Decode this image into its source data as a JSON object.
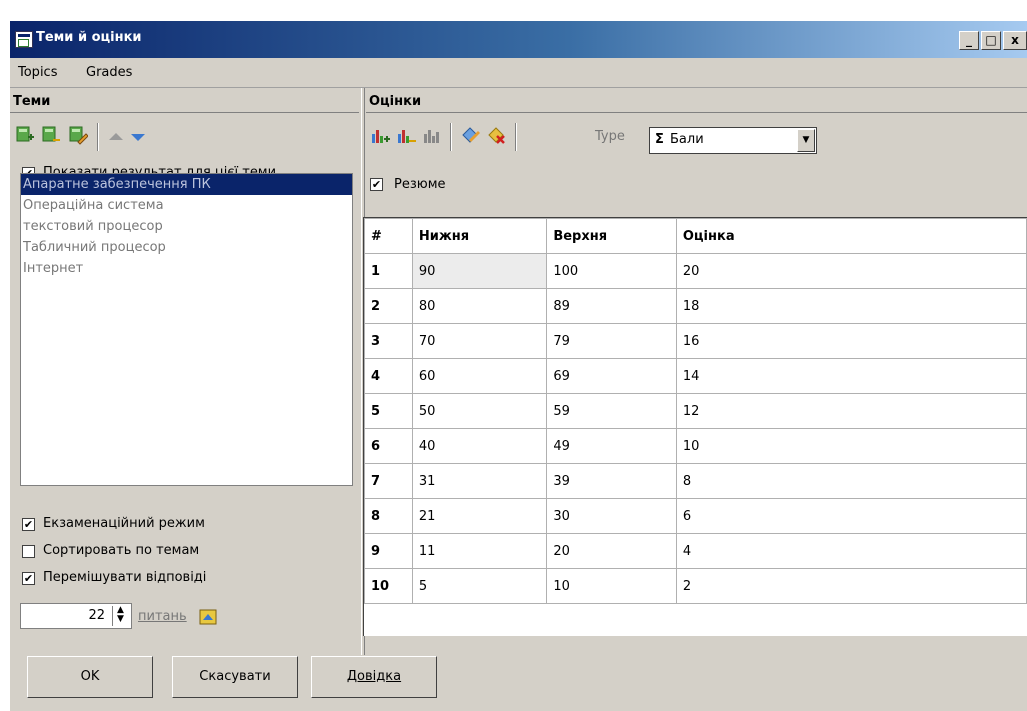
{
  "window": {
    "title": "Теми й оцінки",
    "btn_min": "_",
    "btn_max": "□",
    "btn_close": "x"
  },
  "menu": [
    "Topics",
    "Grades"
  ],
  "topics": {
    "header": "Теми",
    "show_result_label": "Показати результат для цієї теми",
    "items": [
      "Апаратне забезпечення ПК",
      "Операційна система",
      "текстовий процесор",
      "Табличний процесор",
      "Інтернет"
    ],
    "exam_mode_label": "Екзаменаційний режим",
    "sort_label": "Сортировать по темам",
    "shuffle_label": "Перемішувати відповіді",
    "questions_value": "22",
    "questions_label": "питань"
  },
  "grades": {
    "header": "Оцінки",
    "type_label": "Type",
    "type_symbol": "Σ",
    "type_value": "Бали",
    "summary_label": "Резюме",
    "columns": [
      "#",
      "Нижня",
      "Верхня",
      "Оцінка"
    ],
    "rows": [
      [
        "1",
        "90",
        "100",
        "20"
      ],
      [
        "2",
        "80",
        "89",
        "18"
      ],
      [
        "3",
        "70",
        "79",
        "16"
      ],
      [
        "4",
        "60",
        "69",
        "14"
      ],
      [
        "5",
        "50",
        "59",
        "12"
      ],
      [
        "6",
        "40",
        "49",
        "10"
      ],
      [
        "7",
        "31",
        "39",
        "8"
      ],
      [
        "8",
        "21",
        "30",
        "6"
      ],
      [
        "9",
        "11",
        "20",
        "4"
      ],
      [
        "10",
        "5",
        "10",
        "2"
      ]
    ]
  },
  "buttons": {
    "ok": "OK",
    "cancel": "Скасувати",
    "help": "Довідка"
  },
  "colors": {
    "titlebar": "#0a246a",
    "face": "#d4d0c8",
    "selection": "#0a246a"
  }
}
